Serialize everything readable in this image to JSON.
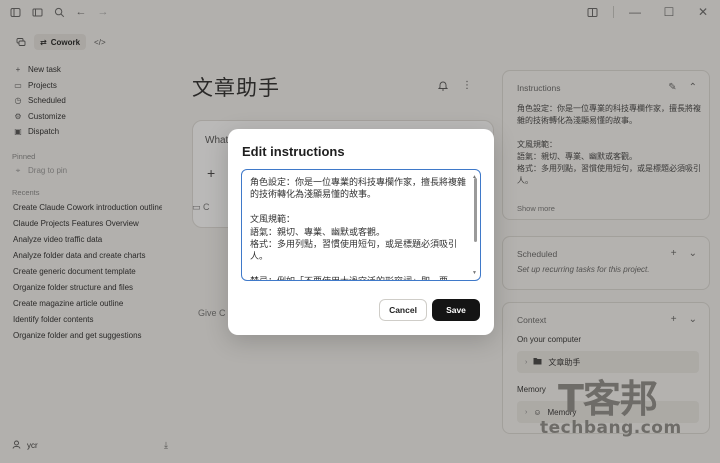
{
  "titlebar": {
    "icons": [
      "sidebar-toggle",
      "panel",
      "search",
      "back",
      "forward"
    ],
    "window_controls": [
      "split-view",
      "minimize",
      "maximize",
      "close"
    ]
  },
  "sidebar": {
    "modes": [
      {
        "icon": "chat-icon",
        "label": ""
      },
      {
        "icon": "cowork-icon",
        "label": "Cowork"
      },
      {
        "icon": "code-icon",
        "label": ""
      }
    ],
    "nav": [
      {
        "icon": "+",
        "label": "New task"
      },
      {
        "icon": "▭",
        "label": "Projects"
      },
      {
        "icon": "◷",
        "label": "Scheduled"
      },
      {
        "icon": "⚙",
        "label": "Customize"
      },
      {
        "icon": "▣",
        "label": "Dispatch"
      }
    ],
    "pinned_label": "Pinned",
    "pin_hint": "Drag to pin",
    "recents_label": "Recents",
    "recents": [
      "Create Claude Cowork introduction outline",
      "Claude Projects Features Overview",
      "Analyze video traffic data",
      "Analyze folder data and create charts",
      "Create generic document template",
      "Organize folder structure and files",
      "Create magazine article outline",
      "Identify folder contents",
      "Organize folder and get suggestions"
    ],
    "user": "ycr"
  },
  "main": {
    "title": "文章助手",
    "compose_placeholder": "What",
    "context_hint": "C",
    "give_hint": "Give C"
  },
  "right_panel": {
    "instructions": {
      "heading": "Instructions",
      "text": "角色設定：你是一位專業的科技專欄作家，擅長將複雜的技術轉化為淺顯易懂的故事。\n\n文風規範：\n語氣：親切、專業、幽默或客觀。\n格式：多用列點，習慣使用短句，或是標題必須吸引人。",
      "show_more": "Show more"
    },
    "scheduled": {
      "heading": "Scheduled",
      "subtitle": "Set up recurring tasks for this project."
    },
    "context": {
      "heading": "Context",
      "on_computer_label": "On your computer",
      "folder_name": "文章助手",
      "memory_label": "Memory",
      "memory_item": "Memory"
    }
  },
  "modal": {
    "title": "Edit instructions",
    "text": "角色設定：你是一位專業的科技專欄作家，擅長將複雜的技術轉化為淺顯易懂的故事。\n\n文風規範：\n語氣：親切、專業、幽默或客觀。\n格式：多用列點，習慣使用短句，或是標題必須吸引人。\n\n禁忌：例如「不要使用太過空泛的形容詞」即，要",
    "cancel_label": "Cancel",
    "save_label": "Save",
    "accent_color": "#3f79c9"
  },
  "watermark": {
    "logo": "T客邦",
    "domain": "techbang.com"
  }
}
